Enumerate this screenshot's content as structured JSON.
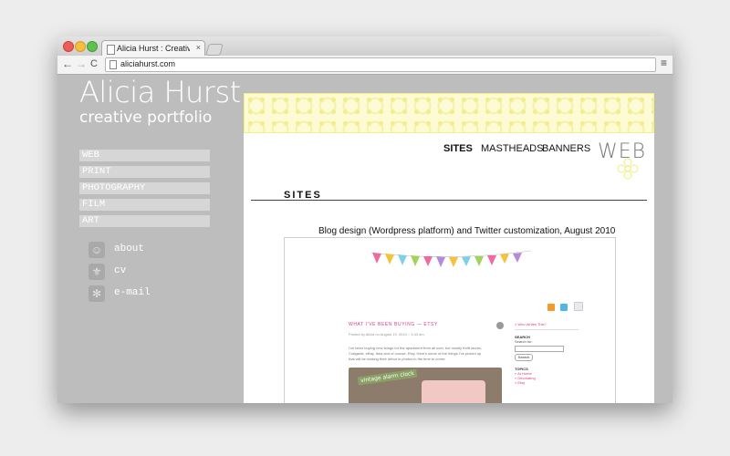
{
  "browser": {
    "tab_title": "Alicia Hurst : Creative Portfolio",
    "tab_close": "×",
    "address": "aliciahurst.com",
    "back_glyph": "←",
    "forward_glyph": "→",
    "reload_glyph": "C",
    "menu_glyph": "≡"
  },
  "site": {
    "name": "Alicia Hurst",
    "tagline": "creative portfolio"
  },
  "categories": [
    {
      "label": "WEB"
    },
    {
      "label": "PRINT"
    },
    {
      "label": "PHOTOGRAPHY"
    },
    {
      "label": "FILM"
    },
    {
      "label": "ART"
    }
  ],
  "side_links": [
    {
      "label": "about",
      "icon": "person-icon",
      "glyph": "☺"
    },
    {
      "label": "cv",
      "icon": "fleur-icon",
      "glyph": "⚜"
    },
    {
      "label": "e-mail",
      "icon": "snowflake-icon",
      "glyph": "✻"
    }
  ],
  "top_nav": {
    "sites": "SITES",
    "mastheads": "MASTHEADS",
    "banners": "BANNERS"
  },
  "section_mark": "WEB",
  "section_heading": "SITES",
  "project": {
    "caption": "Blog design (Wordpress platform) and Twitter customization, August 2010",
    "post_title": "WHAT I'VE BEEN BUYING — ETSY",
    "post_byline": "Posted by Alicia on August 19, 2010 :: 3:43 am",
    "post_body": "I've been buying new things for the apartment from all over, but mostly thrift stores, Craigslist, eBay, Ikea and of course, Etsy. Here's some of the things I've picked up that will be making their debut in photos in the time to come:",
    "photo_sign": "vintage alarm clock",
    "sidebar": {
      "who_link": "» Who Writes This?",
      "search_head": "SEARCH",
      "search_for": "Search for:",
      "search_button": "Search",
      "topics_head": "TOPICS",
      "topics": [
        "» At Home",
        "» Decorating",
        "» Etsy"
      ]
    }
  },
  "colors": {
    "accent_pink": "#e23a82",
    "banner_yellow": "#f3ee86",
    "sidebar_bg": "#bdbdbd"
  }
}
